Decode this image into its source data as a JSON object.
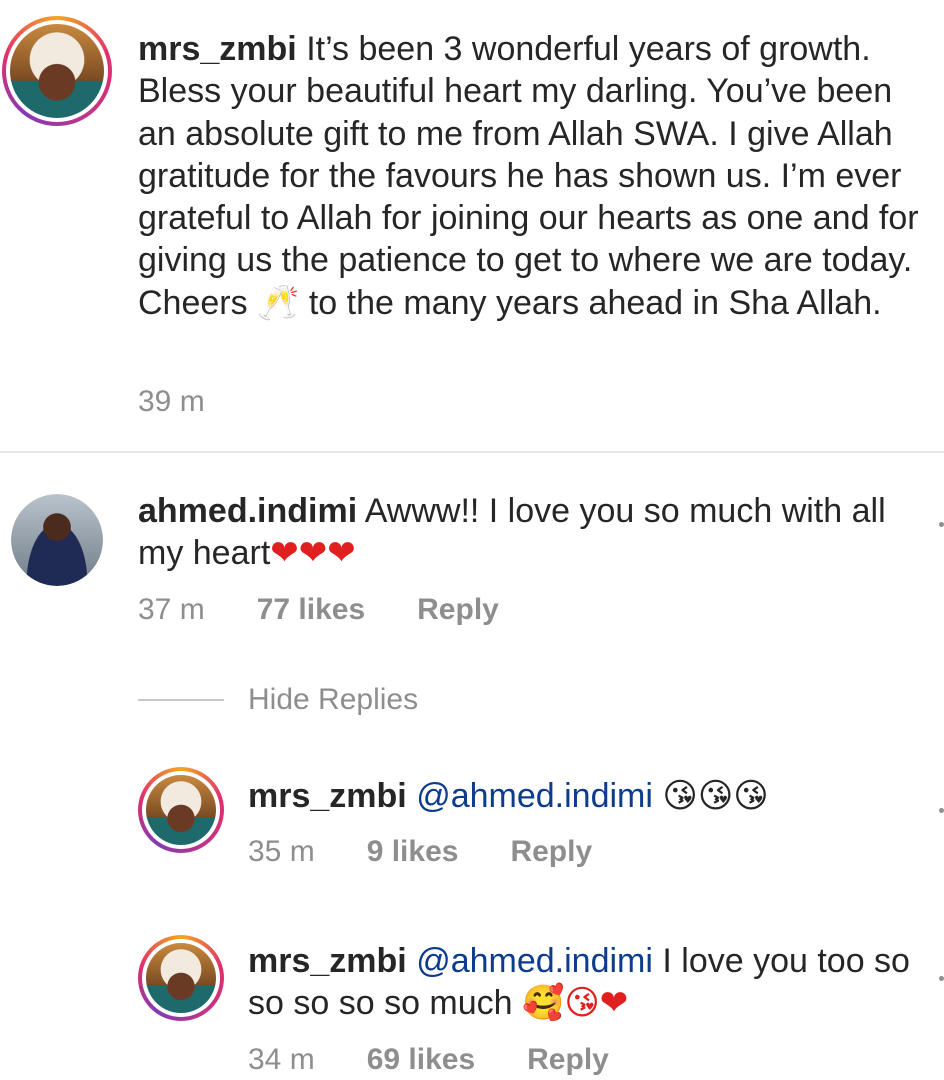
{
  "caption": {
    "username": "mrs_zmbi",
    "text_before_emoji": "It’s been 3 wonderful years of growth. Bless your beautiful heart my darling. You’ve been an absolute gift to me from Allah SWA.  I give Allah gratitude for the favours he has shown us. I’m ever grateful to Allah for joining our hearts as one and for giving us the patience to get to where we are today. Cheers ",
    "emoji": "🥂",
    "text_after_emoji": " to the many years ahead in Sha Allah.",
    "time": "39 m"
  },
  "comment": {
    "username": "ahmed.indimi",
    "text": "Awww!! I love you so much with all my heart",
    "emoji": "❤❤❤",
    "time": "37 m",
    "likes": "77 likes",
    "reply_label": "Reply"
  },
  "hide_replies_label": "Hide Replies",
  "replies": [
    {
      "username": "mrs_zmbi",
      "mention": "@ahmed.indimi",
      "text": "",
      "emoji": "😘😘😘",
      "time": "35 m",
      "likes": "9 likes",
      "reply_label": "Reply"
    },
    {
      "username": "mrs_zmbi",
      "mention": "@ahmed.indimi",
      "text": "I love you too so so so so so much",
      "emoji": "🥰😘❤",
      "time": "34 m",
      "likes": "69 likes",
      "reply_label": "Reply"
    }
  ],
  "colors": {
    "mention": "#0d3c8c",
    "muted": "#8e8e8e",
    "heart": "#e0201e"
  }
}
